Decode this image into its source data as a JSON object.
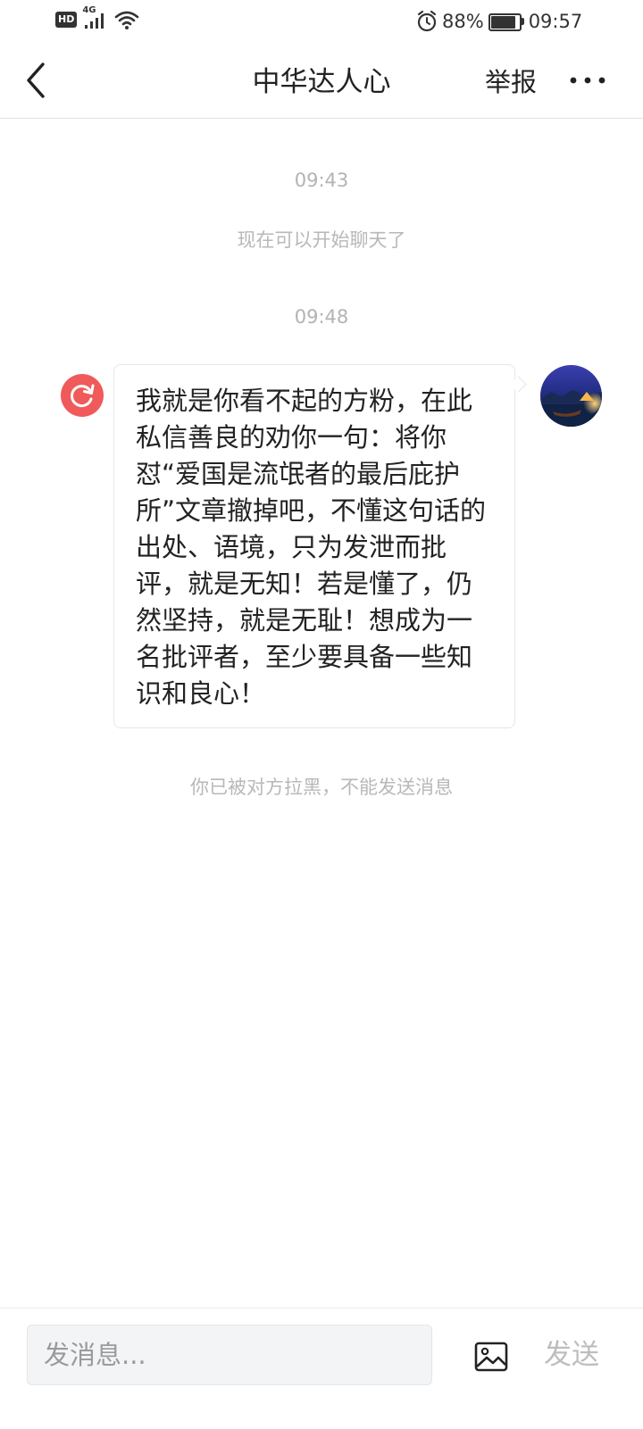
{
  "status_bar": {
    "hd_label": "HD",
    "network_label": "4G",
    "signal_icon": "signal-icon",
    "wifi_icon": "wifi-icon",
    "alarm_icon": "alarm-icon",
    "battery_percent": "88%",
    "battery_level": 0.88,
    "time": "09:57"
  },
  "nav": {
    "back_icon": "chevron-left-icon",
    "title": "中华达人心",
    "report_label": "举报",
    "more_icon": "more-horizontal-icon"
  },
  "messages": {
    "timestamps": [
      "09:43",
      "09:48"
    ],
    "system_start": "现在可以开始聊天了",
    "outgoing": {
      "text": "我就是你看不起的方粉，在此私信善良的劝你一句：将你怼“爱国是流氓者的最后庇护所”文章撤掉吧，不懂这句话的出处、语境，只为发泄而批评，就是无知！若是懂了，仍然坚持，就是无耻！想成为一名批评者，至少要具备一些知识和良心！",
      "status_icon": "resend-icon",
      "avatar_icon": "avatar-image"
    },
    "system_blocked": "你已被对方拉黑，不能发送消息"
  },
  "input_bar": {
    "placeholder": "发消息...",
    "value": "",
    "image_icon": "image-icon",
    "send_label": "发送"
  },
  "colors": {
    "accent_red": "#f05a5a",
    "muted_text": "#b3b3b3",
    "send_disabled": "#bdbdbd"
  }
}
